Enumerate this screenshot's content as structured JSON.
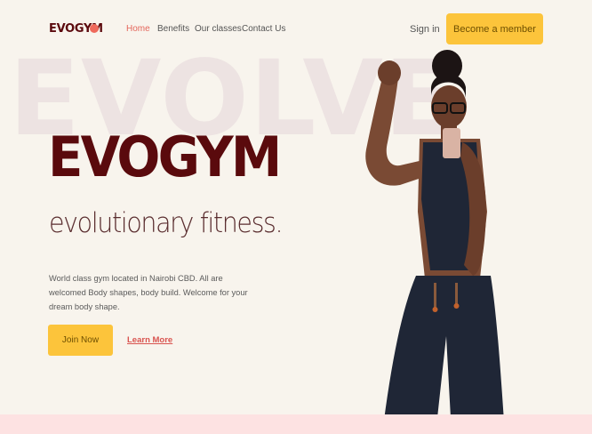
{
  "nav": {
    "logo": "EVOGYM",
    "links": [
      "Home",
      "Benefits",
      "Our classes",
      "Contact Us"
    ],
    "signin": "Sign in",
    "cta": "Become a member"
  },
  "hero": {
    "watermark": "EVOLVE",
    "title": "EVOGYM",
    "subtitle": "evolutionary fitness.",
    "description": "World class gym located in Nairobi CBD. All are welcomed Body shapes, body build. Welcome for your dream body shape.",
    "join_label": "Join Now",
    "learn_more_label": "Learn More"
  },
  "colors": {
    "background": "#f8f4ed",
    "primary_dark": "#5a0a0d",
    "accent_yellow": "#fcc43b",
    "accent_red": "#e4665b",
    "strip_pink": "#fde2e2"
  }
}
